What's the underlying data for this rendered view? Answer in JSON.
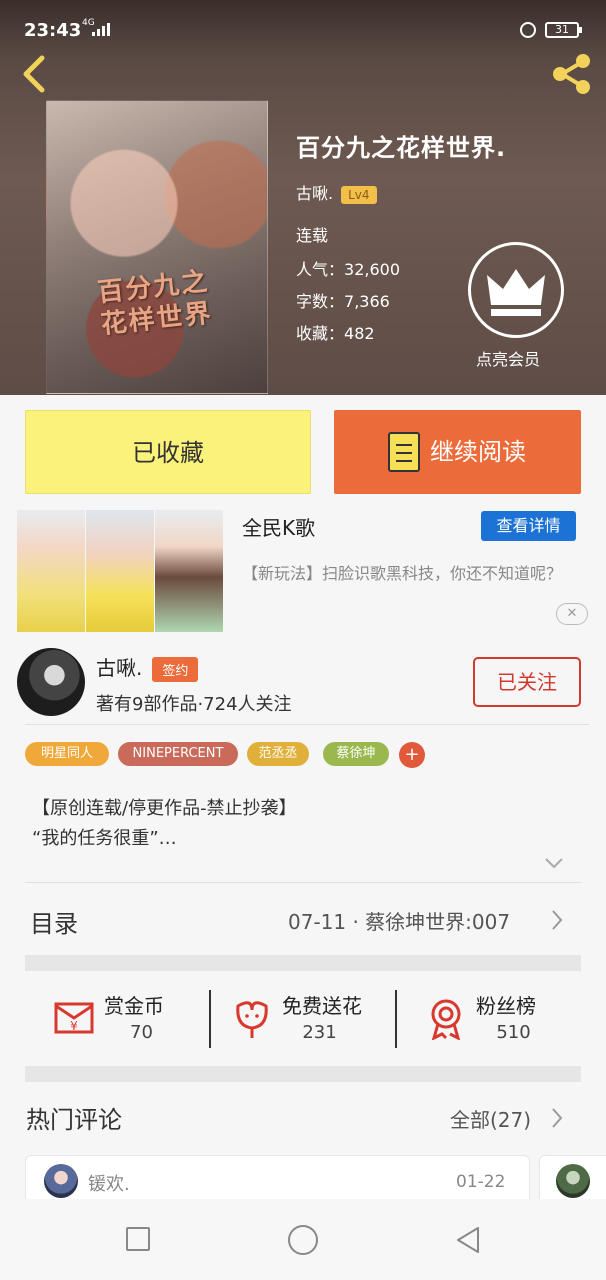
{
  "status": {
    "time": "23:43",
    "network": "4G",
    "battery": "31"
  },
  "book": {
    "title": "百分九之花样世界.",
    "cover_text": "百分九之花样世界",
    "author": "古啾.",
    "level": "Lv4",
    "status": "连载",
    "popularity_label": "人气：",
    "popularity": "32,600",
    "words_label": "字数：",
    "words": "7,366",
    "favorites_label": "收藏：",
    "favorites": "482",
    "vip_label": "点亮会员"
  },
  "actions": {
    "favorited": "已收藏",
    "continue_reading": "继续阅读"
  },
  "ad": {
    "title": "全民K歌",
    "detail_button": "查看详情",
    "description": "【新玩法】扫脸识歌黑科技，你还不知道呢？",
    "close": "✕"
  },
  "author_row": {
    "name": "古啾.",
    "badge": "签约",
    "stats": "著有9部作品·724人关注",
    "follow": "已关注"
  },
  "tags": [
    {
      "label": "明星同人",
      "color": "#f0a83a"
    },
    {
      "label": "NINEPERCENT",
      "color": "#c96a5a"
    },
    {
      "label": "范丞丞",
      "color": "#e0b03a"
    },
    {
      "label": "蔡徐坤",
      "color": "#9ab84e"
    }
  ],
  "tag_more": "+",
  "description": {
    "line1": "【原创连载/停更作品-禁止抄袭】",
    "line2": "“我的任务很重”…"
  },
  "toc": {
    "label": "目录",
    "latest": "07-11 · 蔡徐坤世界:007"
  },
  "rewards": [
    {
      "label": "赏金币",
      "count": "70",
      "icon": "red-envelope-icon"
    },
    {
      "label": "免费送花",
      "count": "231",
      "icon": "flower-icon"
    },
    {
      "label": "粉丝榜",
      "count": "510",
      "icon": "medal-icon"
    }
  ],
  "comments": {
    "title": "热门评论",
    "all": "全部(27)",
    "items": [
      {
        "user": "锾欢.",
        "date": "01-22"
      }
    ]
  },
  "colors": {
    "accent": "#ec6b3a",
    "favorite": "#fbf27c",
    "follow": "#d03a2e",
    "ad_button": "#1d72d6"
  }
}
